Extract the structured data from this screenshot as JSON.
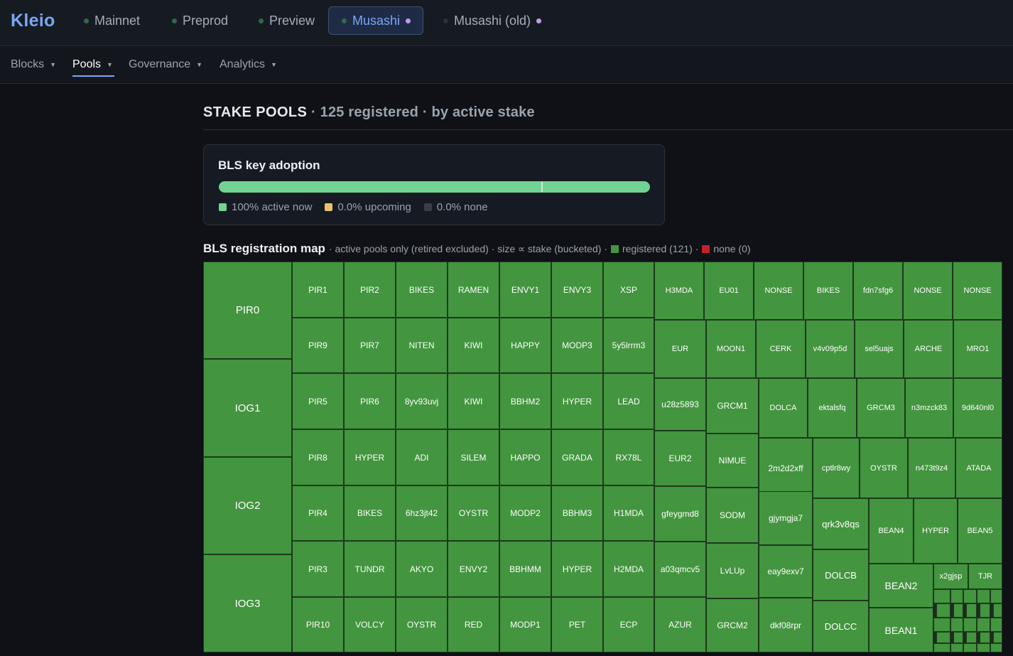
{
  "app": {
    "brand": "Kleio"
  },
  "networks": [
    {
      "label": "Mainnet",
      "active": false,
      "marked": false,
      "dot": "on"
    },
    {
      "label": "Preprod",
      "active": false,
      "marked": false,
      "dot": "on"
    },
    {
      "label": "Preview",
      "active": false,
      "marked": false,
      "dot": "on"
    },
    {
      "label": "Musashi",
      "active": true,
      "marked": true,
      "dot": "on"
    },
    {
      "label": "Musashi (old)",
      "active": false,
      "marked": true,
      "dot": "off"
    }
  ],
  "subnav": [
    {
      "label": "Blocks",
      "active": false
    },
    {
      "label": "Pools",
      "active": true
    },
    {
      "label": "Governance",
      "active": false
    },
    {
      "label": "Analytics",
      "active": false
    }
  ],
  "heading": {
    "title": "STAKE POOLS",
    "subtitle": " · 125 registered · by active stake"
  },
  "adoption": {
    "title": "BLS key adoption",
    "active_fraction": 1.0,
    "legend": [
      {
        "label": "100% active now",
        "color": "#72d494"
      },
      {
        "label": "0.0% upcoming",
        "color": "#e8c36e"
      },
      {
        "label": "0.0% none",
        "color": "#3a3d44"
      }
    ]
  },
  "map": {
    "title": "BLS registration map",
    "description": "· active pools only (retired excluded) · size ∝ stake (bucketed) ·",
    "registered_label": "registered (121) ·",
    "none_label": "none (0)",
    "registered_color": "#43953f",
    "none_color": "#c0212b",
    "pools": [
      "PIR0",
      "IOG1",
      "IOG2",
      "IOG3",
      "PIR1",
      "PIR2",
      "BIKES",
      "RAMEN",
      "ENVY1",
      "ENVY3",
      "XSP",
      "PIR9",
      "PIR7",
      "NITEN",
      "KIWI",
      "HAPPY",
      "MODP3",
      "5y5lrrm3",
      "PIR5",
      "PIR6",
      "8yv93uvj",
      "KIWI",
      "BBHM2",
      "HYPER",
      "LEAD",
      "PIR8",
      "HYPER",
      "ADI",
      "SILEM",
      "HAPPO",
      "GRADA",
      "RX78L",
      "PIR4",
      "BIKES",
      "6hz3jt42",
      "OYSTR",
      "MODP2",
      "BBHM3",
      "H1MDA",
      "PIR3",
      "TUNDR",
      "AKYO",
      "ENVY2",
      "BBHMM",
      "HYPER",
      "H2MDA",
      "PIR10",
      "VOLCY",
      "OYSTR",
      "RED",
      "MODP1",
      "PET",
      "ECP",
      "H3MDA",
      "EU01",
      "NONSE",
      "BIKES",
      "fdn7sfg6",
      "NONSE",
      "NONSE",
      "EUR",
      "MOON1",
      "CERK",
      "v4v09p5d",
      "sel5uajs",
      "ARCHE",
      "MRO1",
      "u28z5893",
      "GRCM1",
      "DOLCA",
      "ektalsfq",
      "GRCM3",
      "n3mzck83",
      "9d640nl0",
      "EUR2",
      "NIMUE",
      "2m2d2xff",
      "cptlr8wy",
      "OYSTR",
      "n473t9z4",
      "ATADA",
      "gfeygmd8",
      "SODM",
      "gjymgja7",
      "qrk3v8qs",
      "BEAN4",
      "HYPER",
      "BEAN5",
      "a03qmcv5",
      "LvLUp",
      "eay9exv7",
      "DOLCB",
      "BEAN2",
      "x2gjsp",
      "TJR",
      "AZUR",
      "GRCM2",
      "dkf08rpr",
      "DOLCC",
      "BEAN1"
    ]
  }
}
